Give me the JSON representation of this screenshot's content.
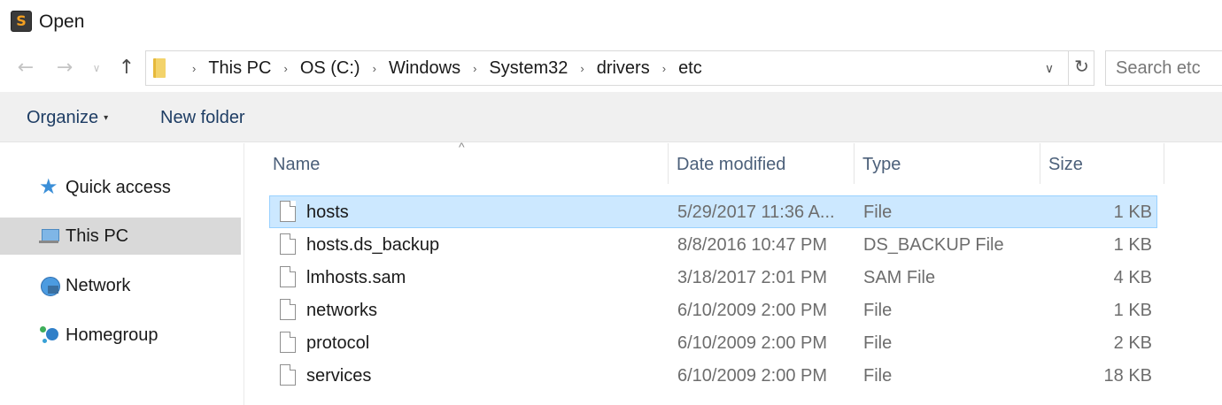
{
  "window": {
    "title": "Open",
    "app_icon": "sublime-text-icon"
  },
  "nav": {
    "back": "←",
    "forward": "→",
    "recent": "∨",
    "up": "↑"
  },
  "address": {
    "crumbs": [
      "This PC",
      "OS (C:)",
      "Windows",
      "System32",
      "drivers",
      "etc"
    ],
    "separator": "›",
    "dropdown": "∨",
    "refresh": "↻"
  },
  "search": {
    "placeholder": "Search etc"
  },
  "toolbar": {
    "organize_label": "Organize",
    "organize_caret": "▾",
    "new_folder_label": "New folder"
  },
  "sidebar": {
    "items": [
      {
        "label": "Quick access",
        "icon": "star-icon",
        "selected": false
      },
      {
        "label": "This PC",
        "icon": "computer-icon",
        "selected": true
      },
      {
        "label": "Network",
        "icon": "network-icon",
        "selected": false
      },
      {
        "label": "Homegroup",
        "icon": "homegroup-icon",
        "selected": false
      }
    ]
  },
  "columns": {
    "sort_indicator": "^",
    "name": "Name",
    "date": "Date modified",
    "type": "Type",
    "size": "Size"
  },
  "files": [
    {
      "name": "hosts",
      "date": "5/29/2017 11:36 A...",
      "type": "File",
      "size": "1 KB",
      "selected": true
    },
    {
      "name": "hosts.ds_backup",
      "date": "8/8/2016 10:47 PM",
      "type": "DS_BACKUP File",
      "size": "1 KB",
      "selected": false
    },
    {
      "name": "lmhosts.sam",
      "date": "3/18/2017 2:01 PM",
      "type": "SAM File",
      "size": "4 KB",
      "selected": false
    },
    {
      "name": "networks",
      "date": "6/10/2009 2:00 PM",
      "type": "File",
      "size": "1 KB",
      "selected": false
    },
    {
      "name": "protocol",
      "date": "6/10/2009 2:00 PM",
      "type": "File",
      "size": "2 KB",
      "selected": false
    },
    {
      "name": "services",
      "date": "6/10/2009 2:00 PM",
      "type": "File",
      "size": "18 KB",
      "selected": false
    }
  ],
  "colors": {
    "selection_bg": "#cce8ff",
    "selection_border": "#99d1ff",
    "nav_selected_bg": "#d9d9d9",
    "command_bar_bg": "#f0f0f0"
  }
}
